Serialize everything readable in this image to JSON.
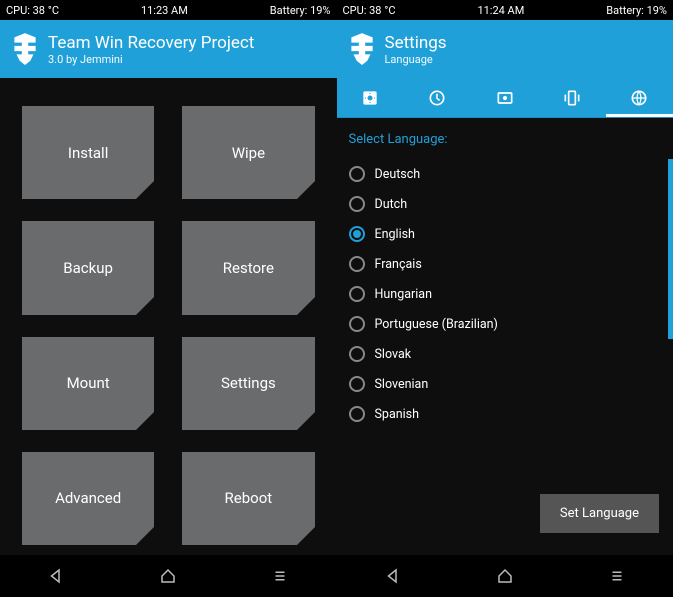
{
  "left": {
    "status": {
      "cpu": "CPU: 38 °C",
      "time": "11:23 AM",
      "battery": "Battery: 19%"
    },
    "header": {
      "title": "Team Win Recovery Project",
      "sub": "3.0 by Jemmini"
    },
    "tiles": [
      "Install",
      "Wipe",
      "Backup",
      "Restore",
      "Mount",
      "Settings",
      "Advanced",
      "Reboot"
    ]
  },
  "right": {
    "status": {
      "cpu": "CPU: 38 °C",
      "time": "11:24 AM",
      "battery": "Battery: 19%"
    },
    "header": {
      "title": "Settings",
      "sub": "Language"
    },
    "section_title": "Select Language:",
    "languages": [
      "Deutsch",
      "Dutch",
      "English",
      "Français",
      "Hungarian",
      "Portuguese (Brazilian)",
      "Slovak",
      "Slovenian",
      "Spanish"
    ],
    "selected_index": 2,
    "scroll_max_index": 5,
    "set_button": "Set Language"
  }
}
